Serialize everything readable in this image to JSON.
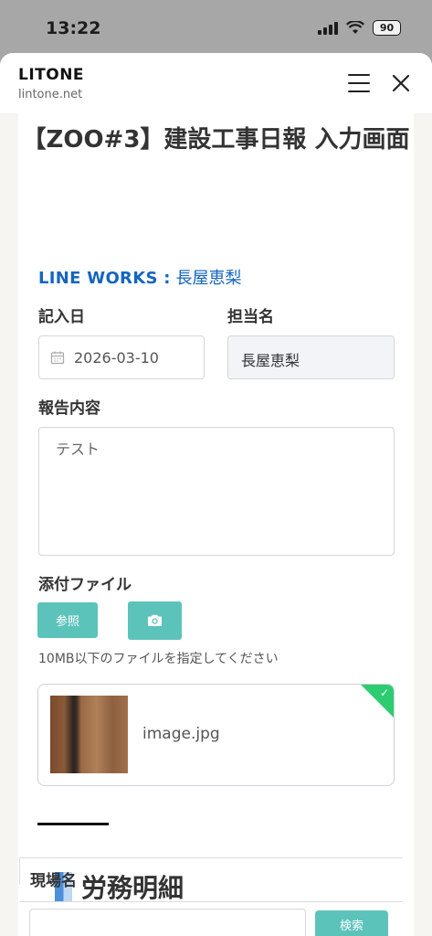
{
  "status": {
    "time": "13:22",
    "battery": "90"
  },
  "header": {
    "title": "LITONE",
    "url": "lintone.net"
  },
  "page": {
    "title": "【ZOO#3】建設工事日報 入力画面"
  },
  "line_works": {
    "label": "LINE WORKS :",
    "name": "長屋恵梨"
  },
  "form": {
    "date_label": "記入日",
    "date_value": "2026-03-10",
    "person_label": "担当名",
    "person_value": "長屋恵梨",
    "report_label": "報告内容",
    "report_value": "テスト",
    "attach_label": "添付ファイル",
    "browse_label": "参照",
    "file_note": "10MB以下のファイルを指定してください",
    "file_name": "image.jpg"
  },
  "labor": {
    "section_title": "労務明細",
    "site_label": "現場名",
    "search_label": "検索"
  },
  "colors": {
    "accent": "#5cc3bb",
    "link": "#1565c0",
    "check": "#2ecc71"
  }
}
